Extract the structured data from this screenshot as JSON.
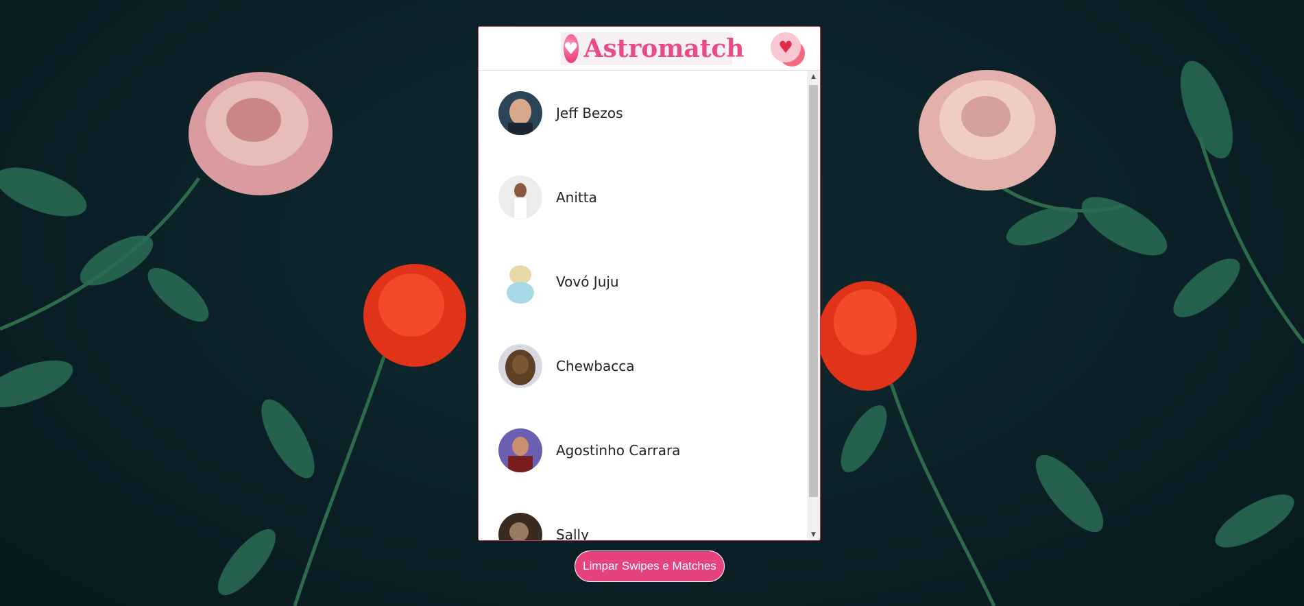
{
  "header": {
    "logo_text": "Astromatch",
    "logo_icon": "heart-icon",
    "matches_icon": "heart-chat-icon"
  },
  "matches": [
    {
      "name": "Jeff Bezos"
    },
    {
      "name": "Anitta"
    },
    {
      "name": "Vovó Juju"
    },
    {
      "name": "Chewbacca"
    },
    {
      "name": "Agostinho Carrara"
    },
    {
      "name": "Sally"
    }
  ],
  "footer": {
    "clear_button_label": "Limpar Swipes e Matches"
  },
  "colors": {
    "accent": "#e6427e",
    "border": "#c8344d",
    "background": "#0b2127"
  }
}
